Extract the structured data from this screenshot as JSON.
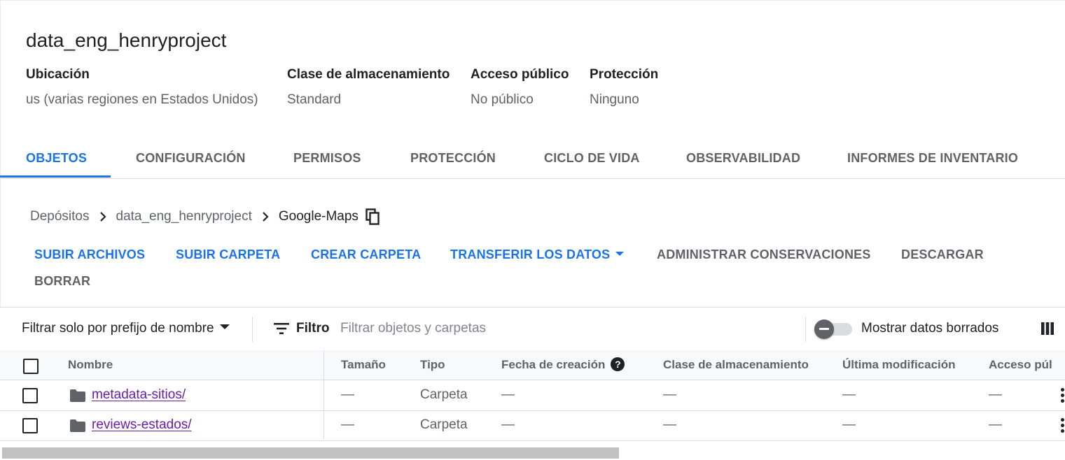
{
  "bucket": {
    "name": "data_eng_henryproject",
    "meta": [
      {
        "label": "Ubicación",
        "value": "us (varias regiones en Estados Unidos)"
      },
      {
        "label": "Clase de almacenamiento",
        "value": "Standard"
      },
      {
        "label": "Acceso público",
        "value": "No público"
      },
      {
        "label": "Protección",
        "value": "Ninguno"
      }
    ]
  },
  "tabs": [
    {
      "label": "OBJETOS",
      "active": true
    },
    {
      "label": "CONFIGURACIÓN"
    },
    {
      "label": "PERMISOS"
    },
    {
      "label": "PROTECCIÓN"
    },
    {
      "label": "CICLO DE VIDA"
    },
    {
      "label": "OBSERVABILIDAD"
    },
    {
      "label": "INFORMES DE INVENTARIO"
    }
  ],
  "breadcrumb": {
    "items": [
      "Depósitos",
      "data_eng_henryproject",
      "Google-Maps"
    ],
    "separator_icon": "chevron-right-icon",
    "copy_icon": "copy-icon"
  },
  "actions": {
    "upload_files": "SUBIR ARCHIVOS",
    "upload_folder": "SUBIR CARPETA",
    "create_folder": "CREAR CARPETA",
    "transfer_data": "TRANSFERIR LOS DATOS",
    "manage_holds": "ADMINISTRAR CONSERVACIONES",
    "download": "DESCARGAR",
    "delete": "BORRAR"
  },
  "filter": {
    "prefix_dropdown": "Filtrar solo por prefijo de nombre",
    "filter_label": "Filtro",
    "placeholder": "Filtrar objetos y carpetas",
    "show_deleted_label": "Mostrar datos borrados",
    "show_deleted_on": false
  },
  "table": {
    "headers": {
      "name": "Nombre",
      "size": "Tamaño",
      "type": "Tipo",
      "created": "Fecha de creación",
      "storage_class": "Clase de almacenamiento",
      "modified": "Última modificación",
      "public_access": "Acceso púl"
    },
    "rows": [
      {
        "name": "metadata-sitios/",
        "size": "—",
        "type": "Carpeta",
        "created": "—",
        "storage_class": "—",
        "modified": "—",
        "public_access": "—"
      },
      {
        "name": "reviews-estados/",
        "size": "—",
        "type": "Carpeta",
        "created": "—",
        "storage_class": "—",
        "modified": "—",
        "public_access": "—"
      }
    ]
  },
  "colors": {
    "accent": "#1a73e8",
    "visited_link": "#681da8",
    "muted_text": "#5f6368",
    "divider": "#dadce0"
  }
}
